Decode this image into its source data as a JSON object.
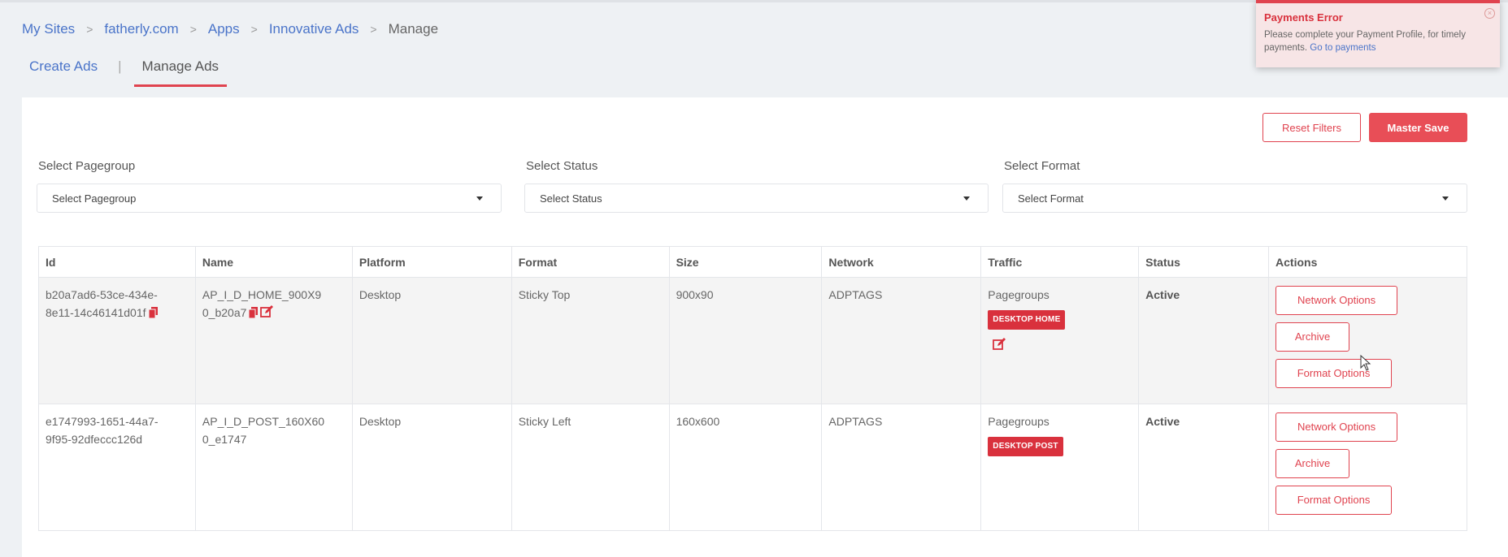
{
  "breadcrumb": [
    "My Sites",
    "fatherly.com",
    "Apps",
    "Innovative Ads",
    "Manage"
  ],
  "breadcrumb_separator": ">",
  "tabs": {
    "create": "Create Ads",
    "separator": "|",
    "manage": "Manage Ads"
  },
  "toolbar": {
    "reset": "Reset Filters",
    "save": "Master Save"
  },
  "filters": {
    "pagegroup": {
      "label": "Select Pagegroup",
      "value": "Select Pagegroup"
    },
    "status": {
      "label": "Select Status",
      "value": "Select Status"
    },
    "format": {
      "label": "Select Format",
      "value": "Select Format"
    }
  },
  "table": {
    "headers": [
      "Id",
      "Name",
      "Platform",
      "Format",
      "Size",
      "Network",
      "Traffic",
      "Status",
      "Actions"
    ],
    "rows": [
      {
        "id_line1": "b20a7ad6-53ce-434e-",
        "id_line2": "8e11-14c46141d01f",
        "name_line1": "AP_I_D_HOME_900X9",
        "name_line2": "0_b20a7",
        "platform": "Desktop",
        "format": "Sticky Top",
        "size": "900x90",
        "network": "ADPTAGS",
        "traffic": "Pagegroups",
        "tag": "DESKTOP HOME",
        "status": "Active"
      },
      {
        "id_line1": "e1747993-1651-44a7-",
        "id_line2": "9f95-92dfeccc126d",
        "name_line1": "AP_I_D_POST_160X60",
        "name_line2": "0_e1747",
        "platform": "Desktop",
        "format": "Sticky Left",
        "size": "160x600",
        "network": "ADPTAGS",
        "traffic": "Pagegroups",
        "tag": "DESKTOP POST",
        "status": "Active"
      }
    ],
    "actions": {
      "network": "Network Options",
      "archive": "Archive",
      "format": "Format Options"
    }
  },
  "toast": {
    "title": "Payments Error",
    "message": "Please complete your Payment Profile, for timely payments.",
    "link": "Go to payments"
  },
  "colors": {
    "accent": "#e0434f",
    "link": "#4a74c9",
    "tag": "#d9313d"
  }
}
